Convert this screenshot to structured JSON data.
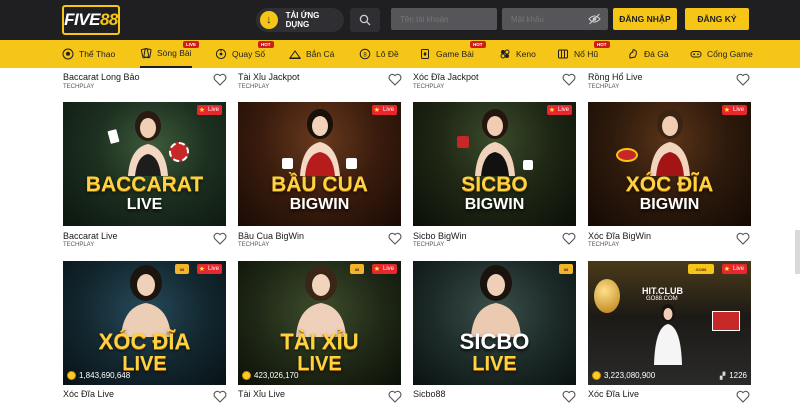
{
  "header": {
    "logo_text_1": "FIVE",
    "logo_text_2": "88",
    "app_label": "TẢI ỨNG DỤNG",
    "username_placeholder": "Tên tài khoản",
    "password_placeholder": "Mật khẩu",
    "login_label": "ĐĂNG NHẬP",
    "register_label": "ĐĂNG KÝ"
  },
  "nav": {
    "items": [
      {
        "label": "Thể Thao",
        "icon": "soccer-ball-icon"
      },
      {
        "label": "Sòng Bài",
        "icon": "cards-icon",
        "tag": "LIVE"
      },
      {
        "label": "Quay Số",
        "icon": "lottery-icon",
        "tag": "HOT"
      },
      {
        "label": "Bắn Cá",
        "icon": "fish-icon"
      },
      {
        "label": "Lô Đề",
        "icon": "lotto-icon"
      },
      {
        "label": "Game Bài",
        "icon": "card-game-icon",
        "tag": "HOT"
      },
      {
        "label": "Keno",
        "icon": "keno-icon"
      },
      {
        "label": "Nổ Hũ",
        "icon": "slot-icon",
        "tag": "HOT"
      },
      {
        "label": "Đá Gà",
        "icon": "rooster-icon"
      },
      {
        "label": "Cổng Game",
        "icon": "gamepad-icon"
      }
    ]
  },
  "row0": [
    {
      "title": "Baccarat Long Bảo",
      "provider": "TECHPLAY"
    },
    {
      "title": "Tài Xỉu Jackpot",
      "provider": "TECHPLAY"
    },
    {
      "title": "Xóc Đĩa Jackpot",
      "provider": "TECHPLAY"
    },
    {
      "title": "Rồng Hổ Live",
      "provider": "TECHPLAY"
    }
  ],
  "row1": [
    {
      "title": "Baccarat Live",
      "provider": "TECHPLAY",
      "name1": "BACCARAT",
      "name2": "LIVE",
      "live": "Live"
    },
    {
      "title": "Bầu Cua BigWin",
      "provider": "TECHPLAY",
      "name1": "BẦU CUA",
      "name2": "BIGWIN",
      "live": "Live"
    },
    {
      "title": "Sicbo BigWin",
      "provider": "TECHPLAY",
      "name1": "SICBO",
      "name2": "BIGWIN",
      "live": "Live"
    },
    {
      "title": "Xóc Đĩa BigWin",
      "provider": "TECHPLAY",
      "name1": "XÓC ĐĨA",
      "name2": "BIGWIN",
      "live": "Live"
    }
  ],
  "row2": [
    {
      "title": "Xóc Đĩa Live",
      "name1": "XÓC ĐĨA",
      "name2": "LIVE",
      "live": "Live",
      "jackpot": "1,843,690,648"
    },
    {
      "title": "Tài Xỉu Live",
      "name1": "TÀI XỈU",
      "name2": "LIVE",
      "live": "Live",
      "jackpot": "423,026,170"
    },
    {
      "title": "Sicbo88",
      "name1": "SICBO",
      "name2": "LIVE"
    },
    {
      "title": "Xóc Đĩa Live",
      "name1": "HIT.CLUB",
      "name2": "GO88.COM",
      "live": "Live",
      "jackpot": "3,223,080,900",
      "players": "1226"
    }
  ],
  "colors": {
    "accent": "#f5c518",
    "topbar": "#1f1f21",
    "live_red": "#e8262d"
  }
}
